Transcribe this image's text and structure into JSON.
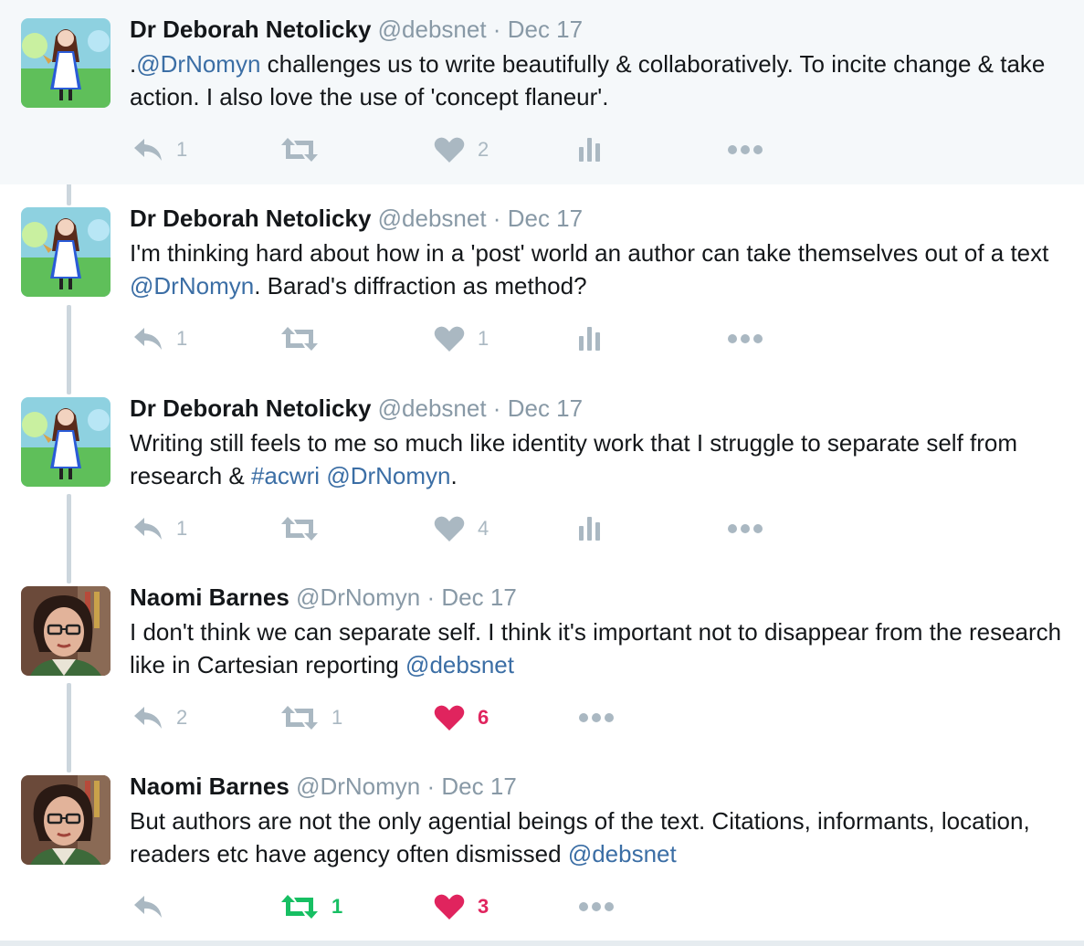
{
  "colors": {
    "like_active": "#e0245e",
    "retweet_active": "#17bf63",
    "link": "#3b6ea5",
    "muted": "#8899a6",
    "action_icon": "#aab8c2",
    "highlight_bg": "#f5f8fa"
  },
  "tweets": [
    {
      "name": "Dr Deborah Netolicky",
      "handle": "@debsnet",
      "sep": "·",
      "date": "Dec 17",
      "text": [
        {
          "t": "."
        },
        {
          "t": "@DrNomyn",
          "link": true
        },
        {
          "t": " challenges us to write beautifully & collaboratively. To incite change & take action. I also love the use of 'concept flaneur'."
        }
      ],
      "reply_count": "1",
      "retweet_count": "",
      "like_count": "2",
      "liked": false,
      "retweeted": false,
      "analytics": true,
      "avatar": "alice-avatar"
    },
    {
      "name": "Dr Deborah Netolicky",
      "handle": "@debsnet",
      "sep": "·",
      "date": "Dec 17",
      "text": [
        {
          "t": "I'm thinking hard about how in a 'post' world an author can take themselves out of a text "
        },
        {
          "t": "@DrNomyn",
          "link": true
        },
        {
          "t": ". Barad's diffraction as method?"
        }
      ],
      "reply_count": "1",
      "retweet_count": "",
      "like_count": "1",
      "liked": false,
      "retweeted": false,
      "analytics": true,
      "avatar": "alice-avatar"
    },
    {
      "name": "Dr Deborah Netolicky",
      "handle": "@debsnet",
      "sep": "·",
      "date": "Dec 17",
      "text": [
        {
          "t": "Writing still feels to me so much like identity work that I struggle to separate self from research & "
        },
        {
          "t": "#acwri",
          "link": true
        },
        {
          "t": " "
        },
        {
          "t": "@DrNomyn",
          "link": true
        },
        {
          "t": "."
        }
      ],
      "reply_count": "1",
      "retweet_count": "",
      "like_count": "4",
      "liked": false,
      "retweeted": false,
      "analytics": true,
      "avatar": "alice-avatar"
    },
    {
      "name": "Naomi Barnes",
      "handle": "@DrNomyn",
      "sep": "·",
      "date": "Dec 17",
      "text": [
        {
          "t": "I don't think we can separate self. I think it's important not to disappear from the research like in Cartesian reporting "
        },
        {
          "t": "@debsnet",
          "link": true
        }
      ],
      "reply_count": "2",
      "retweet_count": "1",
      "like_count": "6",
      "liked": true,
      "retweeted": false,
      "analytics": false,
      "avatar": "woman-glasses-avatar"
    },
    {
      "name": "Naomi Barnes",
      "handle": "@DrNomyn",
      "sep": "·",
      "date": "Dec 17",
      "text": [
        {
          "t": "But authors are not the only agential beings of the text. Citations, informants, location, readers etc have agency often dismissed "
        },
        {
          "t": "@debsnet",
          "link": true
        }
      ],
      "reply_count": "",
      "retweet_count": "1",
      "like_count": "3",
      "liked": true,
      "retweeted": true,
      "analytics": false,
      "avatar": "woman-glasses-avatar"
    }
  ]
}
